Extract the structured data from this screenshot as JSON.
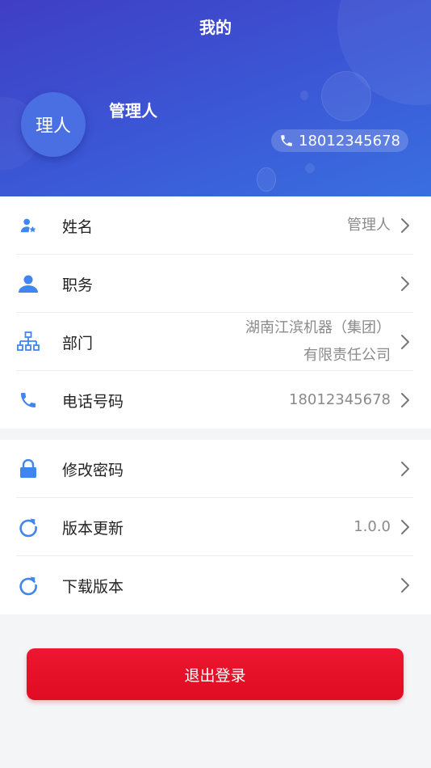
{
  "header": {
    "title": "我的",
    "avatar_text": "理人",
    "name": "管理人",
    "phone": "18012345678"
  },
  "profile_items": [
    {
      "label": "姓名",
      "value": "管理人",
      "icon": "user-star-icon"
    },
    {
      "label": "职务",
      "value": "",
      "icon": "user-icon"
    },
    {
      "label": "部门",
      "value_line1": "湖南江滨机器（集团）",
      "value_line2": "有限责任公司",
      "icon": "org-chart-icon"
    },
    {
      "label": "电话号码",
      "value": "18012345678",
      "icon": "phone-icon"
    }
  ],
  "settings_items": [
    {
      "label": "修改密码",
      "value": "",
      "icon": "lock-icon"
    },
    {
      "label": "版本更新",
      "value": "1.0.0",
      "icon": "refresh-icon"
    },
    {
      "label": "下载版本",
      "value": "",
      "icon": "refresh-icon"
    }
  ],
  "logout_label": "退出登录",
  "colors": {
    "header_start": "#3f3ec4",
    "header_end": "#3a6fe0",
    "icon_blue": "#3f86f0",
    "logout_red": "#e8112a"
  }
}
